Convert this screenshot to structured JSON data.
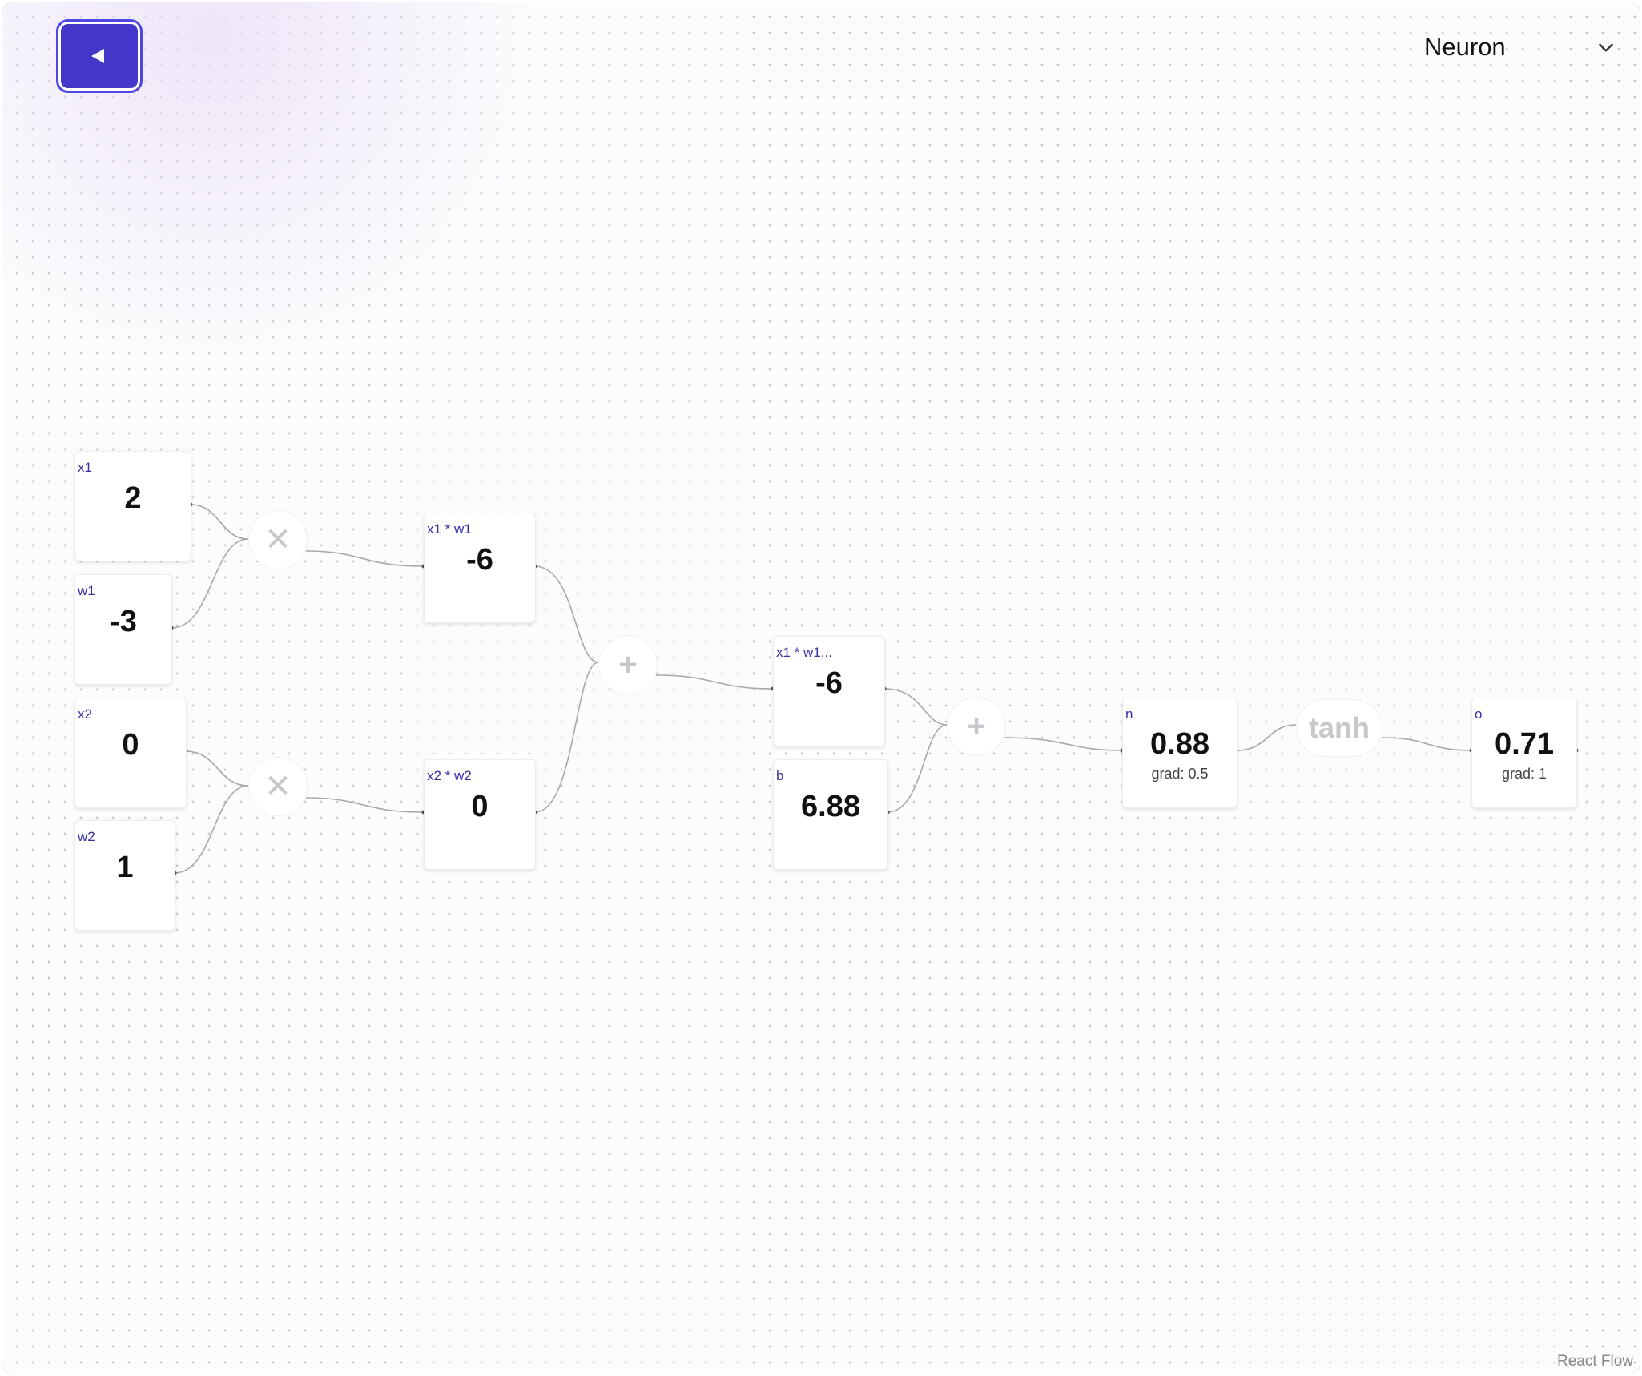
{
  "toolbar": {
    "back_icon": "back-arrow-icon"
  },
  "selector": {
    "selected": "Neuron"
  },
  "nodes": {
    "x1": {
      "label": "x1",
      "value": "2"
    },
    "w1": {
      "label": "w1",
      "value": "-3"
    },
    "x2": {
      "label": "x2",
      "value": "0"
    },
    "w2": {
      "label": "w2",
      "value": "1"
    },
    "x1w1": {
      "label": "x1 * w1",
      "value": "-6"
    },
    "x2w2": {
      "label": "x2 * w2",
      "value": "0"
    },
    "sum1": {
      "label": "x1 * w1...",
      "value": "-6"
    },
    "b": {
      "label": "b",
      "value": "6.88"
    },
    "n": {
      "label": "n",
      "value": "0.88",
      "grad": "grad: 0.5"
    },
    "o": {
      "label": "o",
      "value": "0.71",
      "grad": "grad: 1"
    }
  },
  "ops": {
    "mul1": "✕",
    "mul2": "✕",
    "add1": "+",
    "add2": "+",
    "tanh": "tanh"
  },
  "attribution": "React Flow"
}
